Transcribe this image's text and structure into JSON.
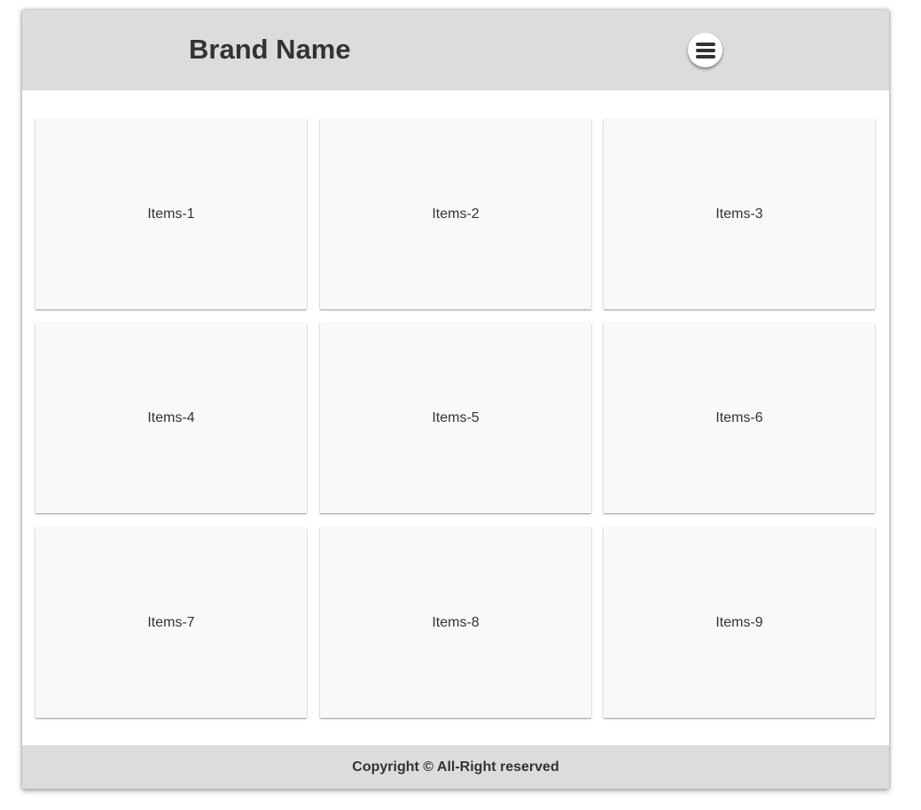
{
  "header": {
    "brand": "Brand Name",
    "menu_icon": "hamburger-menu-icon"
  },
  "items": [
    {
      "label": "Items-1"
    },
    {
      "label": "Items-2"
    },
    {
      "label": "Items-3"
    },
    {
      "label": "Items-4"
    },
    {
      "label": "Items-5"
    },
    {
      "label": "Items-6"
    },
    {
      "label": "Items-7"
    },
    {
      "label": "Items-8"
    },
    {
      "label": "Items-9"
    }
  ],
  "footer": {
    "copyright": "Copyright © All-Right reserved"
  },
  "colors": {
    "header_bg": "#dcdcdc",
    "footer_bg": "#dcdcdc",
    "card_bg": "#f9f9f9",
    "text": "#333333"
  }
}
